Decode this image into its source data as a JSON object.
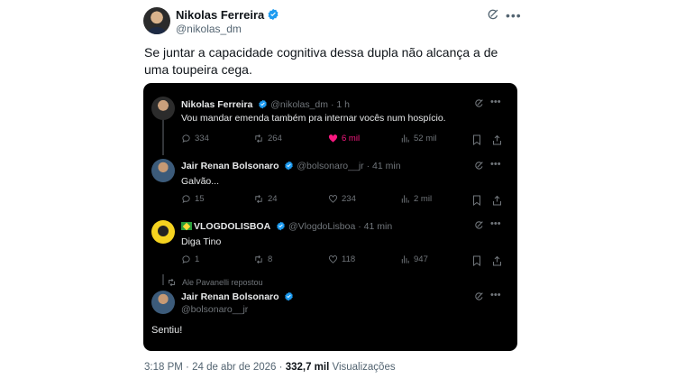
{
  "post": {
    "author_name": "Nikolas Ferreira",
    "author_handle": "@nikolas_dm",
    "text": "Se juntar a capacidade cognitiva dessa dupla não alcança a de uma toupeira cega.",
    "footer": {
      "time": "3:18 PM",
      "date": "24 de abr de 2026",
      "views": "332,7 mil",
      "views_label": "Visualizações",
      "separator": "·"
    }
  },
  "embedded": {
    "tweets": [
      {
        "name": "Nikolas Ferreira",
        "handle": "@nikolas_dm",
        "age": "1 h",
        "text": "Vou mandar emenda também pra internar vocês num hospício.",
        "stats": {
          "replies": "334",
          "reposts": "264",
          "likes": "6 mil",
          "views": "52 mil"
        }
      },
      {
        "name": "Jair Renan Bolsonaro",
        "handle": "@bolsonaro__jr",
        "age": "41 min",
        "text": "Galvão...",
        "stats": {
          "replies": "15",
          "reposts": "24",
          "likes": "234",
          "views": "2 mil"
        }
      },
      {
        "name": "VLOGDOLISBOA",
        "handle": "@VlogdoLisboa",
        "age": "41 min",
        "text": "Diga Tino",
        "stats": {
          "replies": "1",
          "reposts": "8",
          "likes": "118",
          "views": "947"
        }
      }
    ],
    "repost_note": "Ale Pavanelli repostou",
    "repost_tweet": {
      "name": "Jair Renan Bolsonaro",
      "handle": "@bolsonaro__jr",
      "text": "Sentiu!"
    }
  },
  "colors": {
    "verified": "#1d9bf0",
    "like": "#f91880",
    "muted": "#71767b"
  },
  "icons": [
    "verified-badge-icon",
    "grok-icon",
    "more-icon",
    "reply-icon",
    "repost-icon",
    "heart-icon",
    "views-icon",
    "bookmark-icon",
    "share-icon",
    "brazil-flag-icon"
  ]
}
